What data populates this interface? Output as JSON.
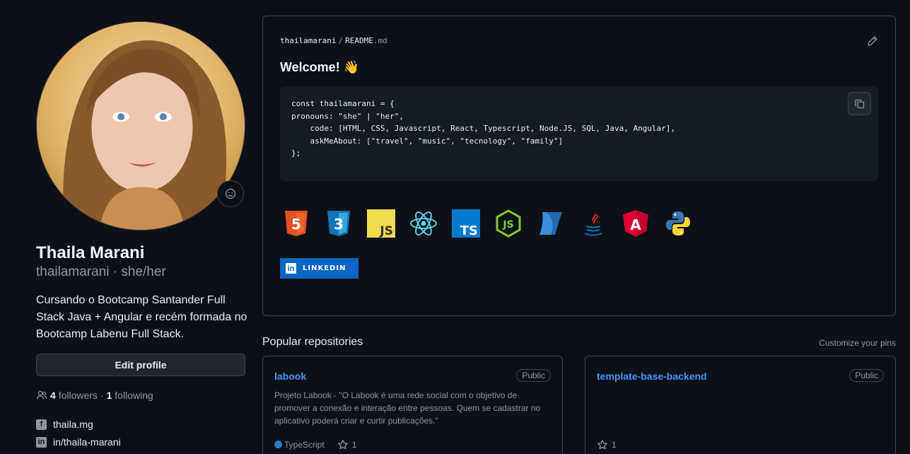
{
  "profile": {
    "name": "Thaila Marani",
    "login_line": "thailamarani · she/her",
    "bio": "Cursando o Bootcamp Santander Full Stack Java + Angular e recém formada no Bootcamp Labenu Full Stack.",
    "edit_button": "Edit profile",
    "followers_count": "4",
    "followers_label": "followers",
    "separator": "·",
    "following_count": "1",
    "following_label": "following",
    "social": [
      {
        "icon": "facebook-icon",
        "text": "thaila.mg"
      },
      {
        "icon": "linkedin-icon",
        "text": "in/thaila-marani"
      }
    ]
  },
  "readme": {
    "user": "thailamarani",
    "separator": "/",
    "file": "README",
    "ext": ".md",
    "heading": "Welcome! 👋",
    "code_lines": [
      "const thailamarani = {",
      "pronouns: \"she\" | \"her\",",
      "    code: [HTML, CSS, Javascript, React, Typescript, Node.JS, SQL, Java, Angular],",
      "    askMeAbout: [\"travel\", \"music\", \"tecnology\", \"family\"]",
      "};"
    ],
    "tech_icons": [
      "html5-icon",
      "css3-icon",
      "javascript-icon",
      "react-icon",
      "typescript-icon",
      "nodejs-icon",
      "sql-icon",
      "java-icon",
      "angular-icon",
      "python-icon"
    ],
    "tech_labels": {
      "html5": "5",
      "css3": "3",
      "javascript": "JS",
      "typescript": "TS",
      "nodejs": "JS",
      "angular": "A"
    },
    "linkedin_badge": {
      "glyph": "in",
      "label": "LINKEDIN"
    }
  },
  "popular": {
    "title": "Popular repositories",
    "customize": "Customize your pins",
    "repos": [
      {
        "name": "labook",
        "visibility": "Public",
        "description": "Projeto Labook - \"O Labook é uma rede social com o objetivo de promover a conexão e interação entre pessoas. Quem se cadastrar no aplicativo poderá criar e curtir publicações.\"",
        "language": "TypeScript",
        "language_color": "#3178c6",
        "stars": "1"
      },
      {
        "name": "template-base-backend",
        "visibility": "Public",
        "description": "",
        "language": "",
        "stars": "1"
      }
    ]
  },
  "colors": {
    "background": "#0d1117",
    "border": "#3d444d",
    "link": "#4493f8",
    "muted": "#8d96a0",
    "linkedin": "#0a66c2"
  }
}
